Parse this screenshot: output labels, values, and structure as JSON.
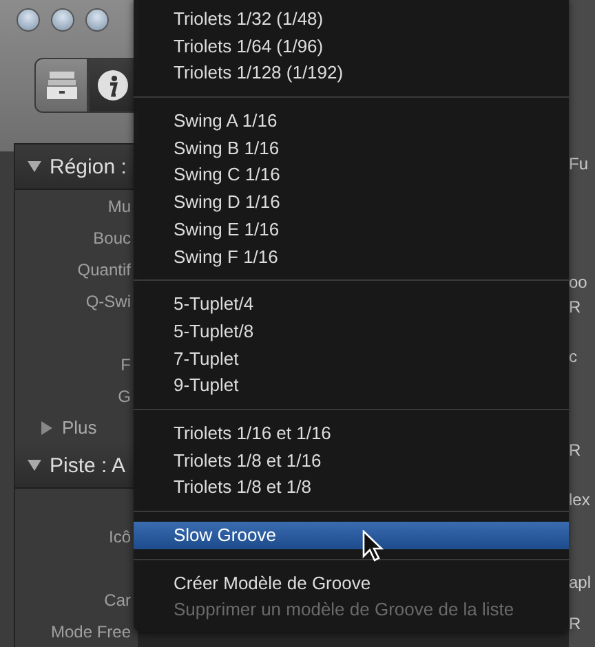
{
  "inspector": {
    "region": {
      "title": "Région :",
      "expanded": true,
      "groups": [
        [
          "Mu",
          "Bouc",
          "Quantif",
          "Q-Swi"
        ],
        [
          "F",
          "G"
        ]
      ],
      "more": {
        "label": "Plus",
        "expanded": false
      }
    },
    "track": {
      "title": "Piste : A",
      "expanded": true,
      "groups": [
        [
          "Icô"
        ],
        [
          "Car",
          "Mode Free"
        ]
      ]
    }
  },
  "right_strip": [
    "Fu",
    "oo",
    "R",
    "c",
    "R",
    "lex",
    "apl",
    "R"
  ],
  "menu": {
    "groups": [
      [
        {
          "label": "Triolets 1/32 (1/48)",
          "selected": false,
          "disabled": false
        },
        {
          "label": "Triolets 1/64 (1/96)",
          "selected": false,
          "disabled": false
        },
        {
          "label": "Triolets 1/128 (1/192)",
          "selected": false,
          "disabled": false
        }
      ],
      [
        {
          "label": "Swing A 1/16",
          "selected": false,
          "disabled": false
        },
        {
          "label": "Swing B 1/16",
          "selected": false,
          "disabled": false
        },
        {
          "label": "Swing C 1/16",
          "selected": false,
          "disabled": false
        },
        {
          "label": "Swing D 1/16",
          "selected": false,
          "disabled": false
        },
        {
          "label": "Swing E 1/16",
          "selected": false,
          "disabled": false
        },
        {
          "label": "Swing F 1/16",
          "selected": false,
          "disabled": false
        }
      ],
      [
        {
          "label": "5-Tuplet/4",
          "selected": false,
          "disabled": false
        },
        {
          "label": "5-Tuplet/8",
          "selected": false,
          "disabled": false
        },
        {
          "label": "7-Tuplet",
          "selected": false,
          "disabled": false
        },
        {
          "label": "9-Tuplet",
          "selected": false,
          "disabled": false
        }
      ],
      [
        {
          "label": "Triolets 1/16 et 1/16",
          "selected": false,
          "disabled": false
        },
        {
          "label": "Triolets 1/8 et 1/16",
          "selected": false,
          "disabled": false
        },
        {
          "label": "Triolets 1/8 et 1/8",
          "selected": false,
          "disabled": false
        }
      ],
      [
        {
          "label": "Slow Groove",
          "selected": true,
          "disabled": false
        }
      ],
      [
        {
          "label": "Créer Modèle de Groove",
          "selected": false,
          "disabled": false
        },
        {
          "label": "Supprimer un modèle de Groove de la liste",
          "selected": false,
          "disabled": true
        }
      ]
    ]
  }
}
